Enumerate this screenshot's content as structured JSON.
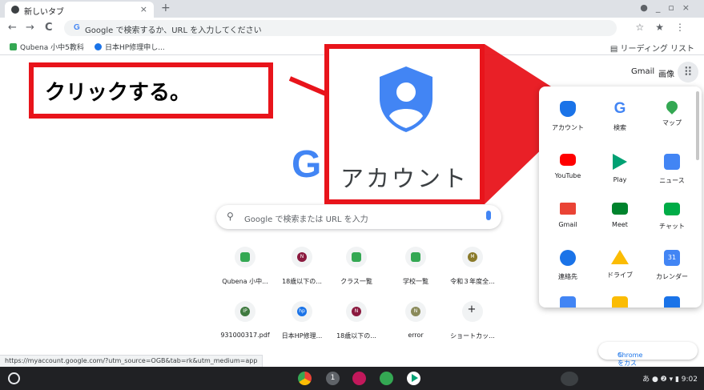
{
  "tab": {
    "title": "新しいタブ",
    "close": "×",
    "new_tab": "+"
  },
  "window_controls": [
    "●",
    "_",
    "▫",
    "×"
  ],
  "toolbar": {
    "back": "←",
    "forward": "→",
    "reload": "C",
    "omnibox_g": "G",
    "omnibox_placeholder": "Google で検索するか、URL を入力してください",
    "star": "☆",
    "extensions": "★",
    "menu": "⋮"
  },
  "bookmarks": [
    {
      "label": "Qubena 小中5教科",
      "color": "#34a853"
    },
    {
      "label": "日本HP修理申し...",
      "color": "#1a73e8"
    }
  ],
  "reading_list": "リーディング リスト",
  "header": {
    "gmail": "Gmail",
    "images": "画像"
  },
  "logo_letter": "G",
  "search": {
    "placeholder": "Google で検索または URL を入力"
  },
  "shortcuts": [
    {
      "label": "Qubena 小中...",
      "icon_text": "",
      "color": "#34a853"
    },
    {
      "label": "18歳以下の...",
      "icon_text": "N",
      "color": "#8b1a3f"
    },
    {
      "label": "クラス一覧",
      "icon_text": "",
      "color": "#34a853"
    },
    {
      "label": "学校一覧",
      "icon_text": "",
      "color": "#34a853"
    },
    {
      "label": "令和３年度全...",
      "icon_text": "M",
      "color": "#8a7a2a"
    },
    {
      "label": "931000317.pdf",
      "icon_text": "IP",
      "color": "#3f7a3f"
    },
    {
      "label": "日本HP修理...",
      "icon_text": "hp",
      "color": "#1a73e8"
    },
    {
      "label": "18歳以下の...",
      "icon_text": "N",
      "color": "#8b1a3f"
    },
    {
      "label": "error",
      "icon_text": "N",
      "color": "#8a8a5a"
    },
    {
      "label": "ショートカッ...",
      "icon_text": "+",
      "color": "#5f6368"
    }
  ],
  "apps": [
    {
      "label": "アカウント",
      "color": "#1a73e8"
    },
    {
      "label": "検索",
      "color": "#4285f4"
    },
    {
      "label": "マップ",
      "color": "#34a853"
    },
    {
      "label": "YouTube",
      "color": "#ff0000"
    },
    {
      "label": "Play",
      "color": "#00a173"
    },
    {
      "label": "ニュース",
      "color": "#4285f4"
    },
    {
      "label": "Gmail",
      "color": "#ea4335"
    },
    {
      "label": "Meet",
      "color": "#00832d"
    },
    {
      "label": "チャット",
      "color": "#00ac47"
    },
    {
      "label": "連絡先",
      "color": "#1a73e8"
    },
    {
      "label": "ドライブ",
      "color": "#fbbc04"
    },
    {
      "label": "カレンダー",
      "color": "#4285f4"
    }
  ],
  "annotation": {
    "callout_text": "クリックする。",
    "zoom_label": "アカウント",
    "color": "#e8141b"
  },
  "customize_label": "Chrome をカスタマイズ",
  "status_url": "https://myaccount.google.com/?utm_source=OGB&tab=rk&utm_medium=app",
  "shelf": {
    "apps": [
      {
        "name": "chrome",
        "color": "#ea4335"
      },
      {
        "name": "1",
        "color": "#5f6368"
      },
      {
        "name": "qr",
        "color": "#c2185b"
      },
      {
        "name": "qubena",
        "color": "#34a853"
      },
      {
        "name": "play",
        "color": "#00a173"
      }
    ],
    "tray": "あ  ● ❷  ▾ ▮ 9:02"
  }
}
